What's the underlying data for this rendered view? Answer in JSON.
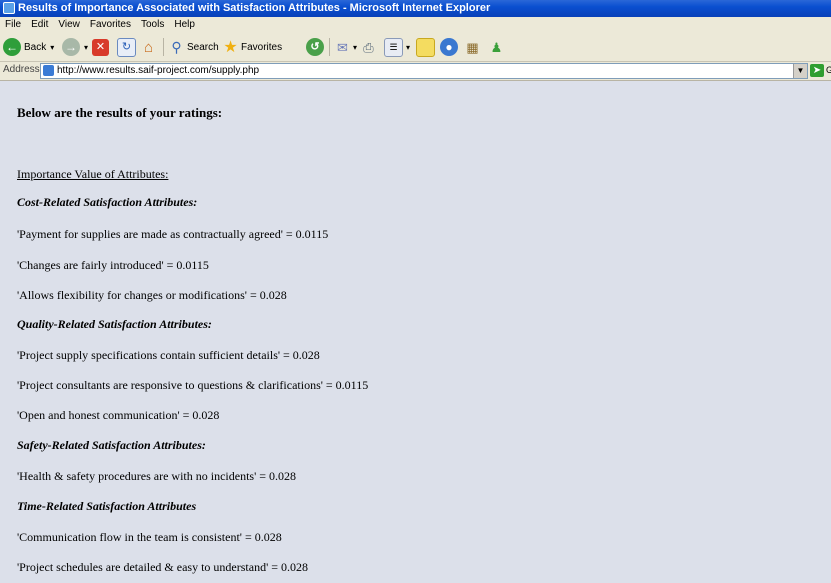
{
  "window": {
    "title": "Results of Importance Associated with Satisfaction Attributes - Microsoft Internet Explorer"
  },
  "menu": [
    "File",
    "Edit",
    "View",
    "Favorites",
    "Tools",
    "Help"
  ],
  "toolbar": {
    "back_label": "Back",
    "search_label": "Search",
    "favorites_label": "Favorites"
  },
  "address": {
    "label": "Address",
    "url": "http://www.results.saif-project.com/supply.php",
    "go_partial": "G"
  },
  "page": {
    "heading": "Below are the results of your ratings:",
    "section_title": "Importance Value of Attributes:",
    "groups": [
      {
        "title": "Cost-Related Satisfaction Attributes:",
        "items": [
          "'Payment for supplies are made as contractually agreed' = 0.0115",
          "'Changes are fairly introduced' = 0.0115",
          "'Allows flexibility for changes or modifications' = 0.028"
        ]
      },
      {
        "title": "Quality-Related Satisfaction Attributes:",
        "items": [
          "'Project supply specifications contain sufficient details' = 0.028",
          "'Project consultants are responsive to questions & clarifications' = 0.0115",
          "'Open and honest communication' = 0.028"
        ]
      },
      {
        "title": "Safety-Related Satisfaction Attributes:",
        "items": [
          "'Health & safety procedures are with no incidents' = 0.028"
        ]
      },
      {
        "title": "Time-Related Satisfaction Attributes",
        "items": [
          "'Communication flow in the team is consistent' = 0.028",
          "'Project schedules are detailed & easy to understand' = 0.028"
        ]
      }
    ]
  }
}
